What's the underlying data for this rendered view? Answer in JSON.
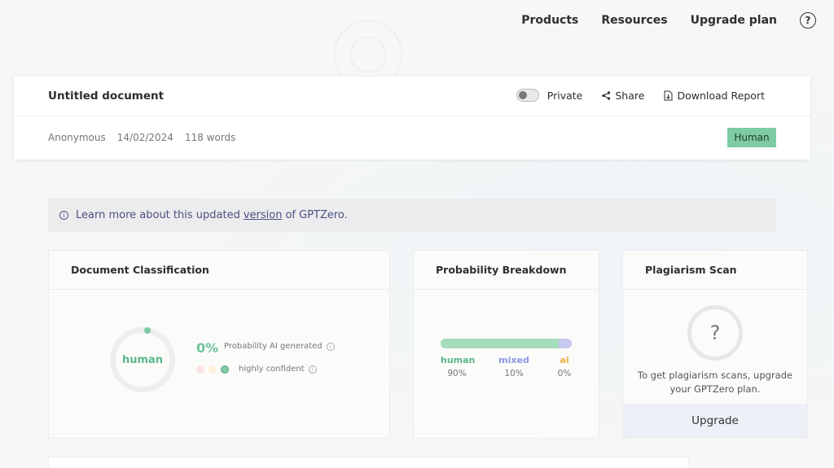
{
  "nav": {
    "products": "Products",
    "resources": "Resources",
    "upgrade_plan": "Upgrade plan",
    "help": "?"
  },
  "document": {
    "title": "Untitled document",
    "private_label": "Private",
    "share_label": "Share",
    "download_label": "Download Report",
    "author": "Anonymous",
    "date": "14/02/2024",
    "words": "118 words",
    "badge": "Human"
  },
  "banner": {
    "prefix": "Learn more about this updated",
    "link": "version",
    "suffix": "of GPTZero."
  },
  "classification": {
    "title": "Document Classification",
    "ring_label": "human",
    "ai_percent": "0%",
    "ai_label": "Probability AI generated",
    "confidence_label": "highly confident"
  },
  "breakdown": {
    "title": "Probability Breakdown",
    "items": [
      {
        "name": "human",
        "value": "90%",
        "fraction": 0.9,
        "color": "#5ab88a"
      },
      {
        "name": "mixed",
        "value": "10%",
        "fraction": 0.1,
        "color": "#8e95e6"
      },
      {
        "name": "ai",
        "value": "0%",
        "fraction": 0.0,
        "color": "#f0b142"
      }
    ]
  },
  "plagiarism": {
    "title": "Plagiarism Scan",
    "icon": "?",
    "text": "To get plagiarism scans, upgrade your GPTZero plan.",
    "button": "Upgrade"
  },
  "colors": {
    "accent_green": "#7fcba3",
    "banner_text": "#4a5080"
  }
}
